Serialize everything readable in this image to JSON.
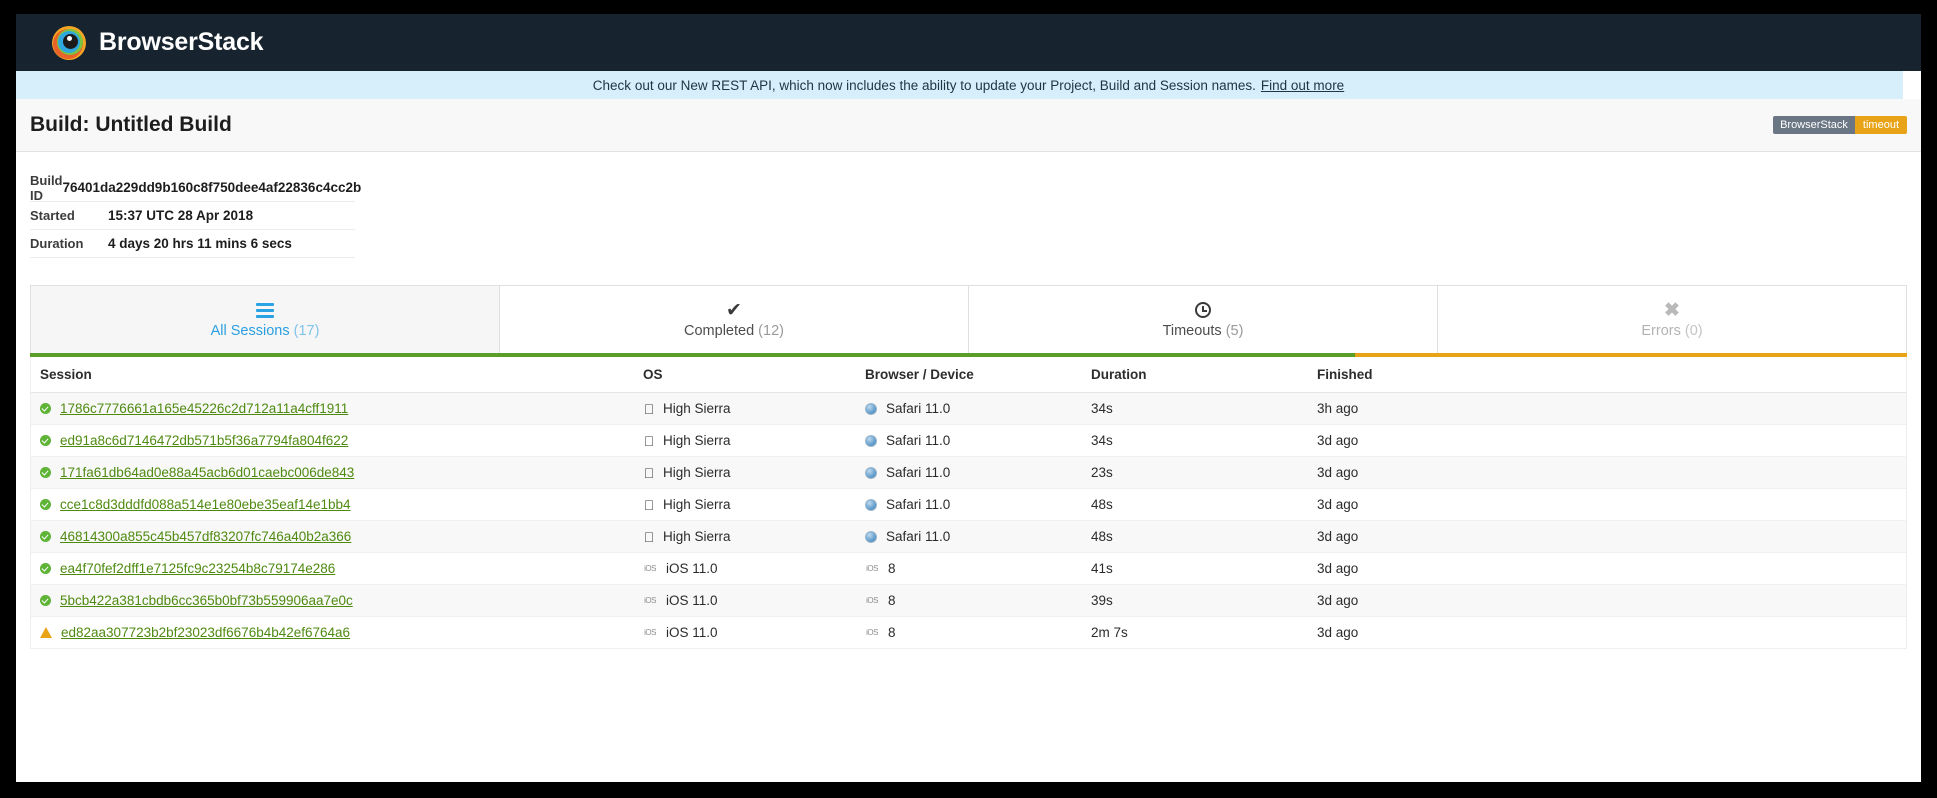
{
  "brand": {
    "name": "BrowserStack",
    "logo_icon": "browserstack-eye-logo"
  },
  "announcement": {
    "text": "Check out our New REST API, which now includes the ability to update your Project, Build and Session names.",
    "link_label": "Find out more"
  },
  "build": {
    "title": "Build: Untitled Build",
    "badge_left": "BrowserStack",
    "badge_right": "timeout",
    "meta": [
      {
        "label": "Build ID",
        "value": "76401da229dd9b160c8f750dee4af22836c4cc2b"
      },
      {
        "label": "Started",
        "value": "15:37 UTC 28 Apr 2018"
      },
      {
        "label": "Duration",
        "value": "4 days 20 hrs 11 mins 6 secs"
      }
    ]
  },
  "tabs": [
    {
      "label": "All Sessions",
      "count": "(17)",
      "icon": "list-icon",
      "active": true,
      "disabled": false
    },
    {
      "label": "Completed",
      "count": "(12)",
      "icon": "check-icon",
      "active": false,
      "disabled": false
    },
    {
      "label": "Timeouts",
      "count": "(5)",
      "icon": "clock-icon",
      "active": false,
      "disabled": false
    },
    {
      "label": "Errors",
      "count": "(0)",
      "icon": "close-icon",
      "active": false,
      "disabled": true
    }
  ],
  "table": {
    "columns": [
      "Session",
      "OS",
      "Browser / Device",
      "Duration",
      "Finished"
    ],
    "rows": [
      {
        "status": "passed",
        "session": "1786c7776661a165e45226c2d712a11a4cff1911",
        "os_icon": "apple-icon",
        "os": "High Sierra",
        "browser_icon": "safari-icon",
        "browser": "Safari 11.0",
        "duration": "34s",
        "finished": "3h ago"
      },
      {
        "status": "passed",
        "session": "ed91a8c6d7146472db571b5f36a7794fa804f622",
        "os_icon": "apple-icon",
        "os": "High Sierra",
        "browser_icon": "safari-icon",
        "browser": "Safari 11.0",
        "duration": "34s",
        "finished": "3d ago"
      },
      {
        "status": "passed",
        "session": "171fa61db64ad0e88a45acb6d01caebc006de843",
        "os_icon": "apple-icon",
        "os": "High Sierra",
        "browser_icon": "safari-icon",
        "browser": "Safari 11.0",
        "duration": "23s",
        "finished": "3d ago"
      },
      {
        "status": "passed",
        "session": "cce1c8d3dddfd088a514e1e80ebe35eaf14e1bb4",
        "os_icon": "apple-icon",
        "os": "High Sierra",
        "browser_icon": "safari-icon",
        "browser": "Safari 11.0",
        "duration": "48s",
        "finished": "3d ago"
      },
      {
        "status": "passed",
        "session": "46814300a855c45b457df83207fc746a40b2a366",
        "os_icon": "apple-icon",
        "os": "High Sierra",
        "browser_icon": "safari-icon",
        "browser": "Safari 11.0",
        "duration": "48s",
        "finished": "3d ago"
      },
      {
        "status": "passed",
        "session": "ea4f70fef2dff1e7125fc9c23254b8c79174e286",
        "os_icon": "ios-icon",
        "os": "iOS 11.0",
        "browser_icon": "ios-icon",
        "browser": "8",
        "duration": "41s",
        "finished": "3d ago"
      },
      {
        "status": "passed",
        "session": "5bcb422a381cbdb6cc365b0bf73b559906aa7e0c",
        "os_icon": "ios-icon",
        "os": "iOS 11.0",
        "browser_icon": "ios-icon",
        "browser": "8",
        "duration": "39s",
        "finished": "3d ago"
      },
      {
        "status": "timeout",
        "session": "ed82aa307723b2bf23023df6676b4b42ef6764a6",
        "os_icon": "ios-icon",
        "os": "iOS 11.0",
        "browser_icon": "ios-icon",
        "browser": "8",
        "duration": "2m 7s",
        "finished": "3d ago"
      }
    ]
  },
  "colors": {
    "nav_bg": "#17242f",
    "announce_bg": "#d7eefb",
    "accent_blue": "#29a3e3",
    "pass_green": "#5fb336",
    "link_green": "#4f8a10",
    "warn_orange": "#e8a317",
    "tab_underline_green": "#5a9e28"
  }
}
